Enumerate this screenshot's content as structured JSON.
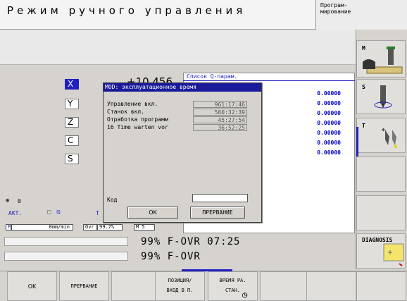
{
  "header": {
    "title": "Режим ручного управления",
    "program_mode_line1": "Програм-",
    "program_mode_line2": "мирование"
  },
  "axes": [
    {
      "label": "X",
      "value": "+10.456"
    },
    {
      "label": "Y",
      "value": ""
    },
    {
      "label": "Z",
      "value": ""
    },
    {
      "label": "C",
      "value": ""
    },
    {
      "label": "S",
      "value": ""
    }
  ],
  "qparam": {
    "title": "Список Q-парам.",
    "values": [
      "0.00000",
      "0.00000",
      "0.00000",
      "0.00000",
      "0.00000",
      "0.00000",
      "0.00000"
    ]
  },
  "dialog": {
    "title": "MOD: эксплуатационное время",
    "rows": [
      {
        "label": "Управление вкл.",
        "value": "961:17:46"
      },
      {
        "label": "Станок вкл.",
        "value": "560:32:39"
      },
      {
        "label": "Отработка программ",
        "value": "45:27:54"
      },
      {
        "label": "16 Time warten vor",
        "value": "36:52:25"
      }
    ],
    "code_label": "Код",
    "ok_label": "OK",
    "cancel_label": "ПРЕРВАНИЕ"
  },
  "status": {
    "indicator_value": "0",
    "akt_label": "АКТ.",
    "t_label": "T",
    "f_label": "F",
    "f_value": "0mm/min",
    "ovr_label": "Ovr",
    "ovr_value": "99.7%",
    "m_label": "M 5"
  },
  "overrides": {
    "line1": "99% F-OVR 07:25",
    "line2": "99% F-OVR"
  },
  "right_softkeys": {
    "m_label": "M",
    "s_label": "S",
    "t_label": "T",
    "diagnosis_label": "DIAGNOSIS"
  },
  "bottom_softkeys": {
    "ok": "OK",
    "cancel": "ПРЕРВАНИЕ",
    "position_line1": "ПОЗИЦИЯ/",
    "position_line2": "ВХОД В П.",
    "time_line1": "ВРЕМЯ РА.",
    "time_line2": "СТАН."
  },
  "colors": {
    "accent": "#1f1fbf",
    "dialog_title_bg": "#1a1a9a",
    "panel_bg": "#d6d3ce"
  }
}
